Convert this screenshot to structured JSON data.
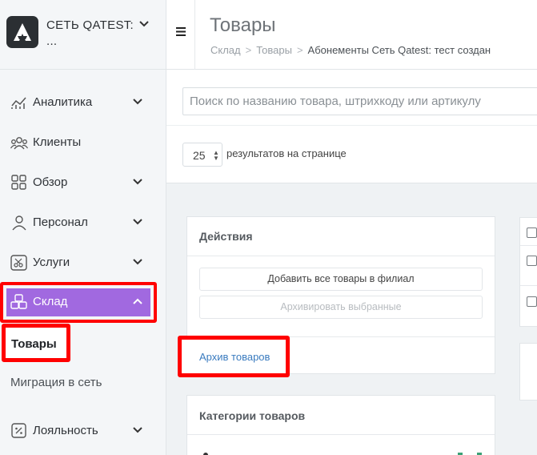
{
  "brand": {
    "name": "СЕТЬ QATEST: ..."
  },
  "sidebar": {
    "items": [
      {
        "label": "Аналитика",
        "icon": "analytics-icon",
        "has_chevron": true
      },
      {
        "label": "Клиенты",
        "icon": "clients-icon",
        "has_chevron": false
      },
      {
        "label": "Обзор",
        "icon": "overview-icon",
        "has_chevron": true
      },
      {
        "label": "Персонал",
        "icon": "staff-icon",
        "has_chevron": true
      },
      {
        "label": "Услуги",
        "icon": "scissors-icon",
        "has_chevron": true
      },
      {
        "label": "Склад",
        "icon": "warehouse-icon",
        "has_chevron": true,
        "active": true
      },
      {
        "label": "Лояльность",
        "icon": "loyalty-icon",
        "has_chevron": true
      }
    ],
    "subitems": [
      {
        "label": "Товары",
        "active": true
      },
      {
        "label": "Миграция в сеть",
        "active": false
      }
    ]
  },
  "header": {
    "title": "Товары",
    "breadcrumb": [
      "Склад",
      "Товары",
      "Абонементы Сеть Qatest: тест создан"
    ]
  },
  "search": {
    "placeholder": "Поиск по названию товара, штрихкоду или артикулу"
  },
  "pagination": {
    "per_page": "25",
    "label": "результатов на странице"
  },
  "actions": {
    "title": "Действия",
    "add_all_label": "Добавить все товары в филиал",
    "archive_selected_label": "Архивировать выбранные",
    "archive_link": "Архив товаров"
  },
  "categories": {
    "title": "Категории товаров"
  },
  "colors": {
    "accent": "#a169e0",
    "highlight": "#ff0000",
    "link": "#3a7bbf"
  }
}
